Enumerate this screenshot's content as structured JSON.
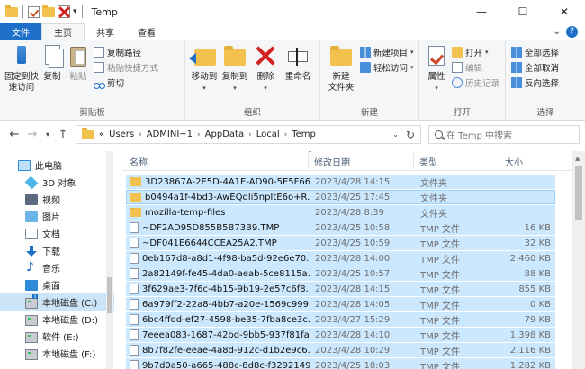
{
  "window": {
    "title": "Temp",
    "minimize": "—",
    "maximize": "☐",
    "close": "✕"
  },
  "tabs": [
    {
      "label": "文件"
    },
    {
      "label": "主页"
    },
    {
      "label": "共享"
    },
    {
      "label": "查看"
    }
  ],
  "ribbon": {
    "clipboard": {
      "label": "剪贴板",
      "pin": "固定到快\n速访问",
      "copy": "复制",
      "paste": "粘贴",
      "copy_path": "复制路径",
      "paste_shortcut": "粘贴快捷方式",
      "cut": "剪切"
    },
    "organize": {
      "label": "组织",
      "move_to": "移动到",
      "copy_to": "复制到",
      "delete": "删除",
      "rename": "重命名"
    },
    "new": {
      "label": "新建",
      "new_folder": "新建\n文件夹",
      "new_item": "新建项目",
      "easy_access": "轻松访问"
    },
    "open": {
      "label": "打开",
      "properties": "属性",
      "open": "打开",
      "edit": "编辑",
      "history": "历史记录"
    },
    "select": {
      "label": "选择",
      "select_all": "全部选择",
      "select_none": "全部取消",
      "invert": "反向选择"
    }
  },
  "address": {
    "overflow": "«",
    "crumbs": [
      "Users",
      "ADMINI~1",
      "AppData",
      "Local",
      "Temp"
    ],
    "search_placeholder": "在 Temp 中搜索"
  },
  "nav": [
    {
      "label": "此电脑",
      "icon": "pc-icon"
    },
    {
      "label": "3D 对象",
      "icon": "3d-objects-icon"
    },
    {
      "label": "视频",
      "icon": "video-icon"
    },
    {
      "label": "图片",
      "icon": "pictures-icon"
    },
    {
      "label": "文档",
      "icon": "documents-icon"
    },
    {
      "label": "下载",
      "icon": "downloads-icon"
    },
    {
      "label": "音乐",
      "icon": "music-icon"
    },
    {
      "label": "桌面",
      "icon": "desktop-icon"
    },
    {
      "label": "本地磁盘 (C:)",
      "icon": "drive-icon"
    },
    {
      "label": "本地磁盘 (D:)",
      "icon": "drive-icon"
    },
    {
      "label": "软件 (E:)",
      "icon": "drive-icon"
    },
    {
      "label": "本地磁盘 (F:)",
      "icon": "drive-icon"
    }
  ],
  "columns": {
    "name": "名称",
    "date": "修改日期",
    "type": "类型",
    "size": "大小"
  },
  "files": [
    {
      "name": "3D23867A-2E5D-4A1E-AD90-5E5F664...",
      "date": "2023/4/28 14:15",
      "type": "文件夹",
      "size": "",
      "kind": "folder"
    },
    {
      "name": "b0494a1f-4bd3-AwEQqli5npItE6o+R...",
      "date": "2023/4/25 17:45",
      "type": "文件夹",
      "size": "",
      "kind": "folder"
    },
    {
      "name": "mozilla-temp-files",
      "date": "2023/4/28 8:39",
      "type": "文件夹",
      "size": "",
      "kind": "folder"
    },
    {
      "name": "~DF2AD95D855B5B73B9.TMP",
      "date": "2023/4/25 10:58",
      "type": "TMP 文件",
      "size": "16 KB",
      "kind": "file"
    },
    {
      "name": "~DF041E6644CCEA25A2.TMP",
      "date": "2023/4/25 10:59",
      "type": "TMP 文件",
      "size": "32 KB",
      "kind": "file"
    },
    {
      "name": "0eb167d8-a8d1-4f98-ba5d-92e6e70...",
      "date": "2023/4/28 14:00",
      "type": "TMP 文件",
      "size": "2,460 KB",
      "kind": "file"
    },
    {
      "name": "2a82149f-fe45-4da0-aeab-5ce8115a...",
      "date": "2023/4/25 10:57",
      "type": "TMP 文件",
      "size": "88 KB",
      "kind": "file"
    },
    {
      "name": "3f629ae3-7f6c-4b15-9b19-2e57c6f8...",
      "date": "2023/4/28 14:15",
      "type": "TMP 文件",
      "size": "855 KB",
      "kind": "file"
    },
    {
      "name": "6a979ff2-22a8-4bb7-a20e-1569c999...",
      "date": "2023/4/28 14:05",
      "type": "TMP 文件",
      "size": "0 KB",
      "kind": "file"
    },
    {
      "name": "6bc4ffdd-ef27-4598-be35-7fba8ce3c...",
      "date": "2023/4/27 15:29",
      "type": "TMP 文件",
      "size": "79 KB",
      "kind": "file"
    },
    {
      "name": "7eeea083-1687-42bd-9bb5-937f81fa...",
      "date": "2023/4/28 14:10",
      "type": "TMP 文件",
      "size": "1,398 KB",
      "kind": "file"
    },
    {
      "name": "8b7f82fe-eeae-4a8d-912c-d1b2e9c6...",
      "date": "2023/4/28 10:29",
      "type": "TMP 文件",
      "size": "2,116 KB",
      "kind": "file"
    },
    {
      "name": "9b7d0a50-a665-488c-8d8c-f3292149...",
      "date": "2023/4/25 18:03",
      "type": "TMP 文件",
      "size": "1,282 KB",
      "kind": "file"
    }
  ]
}
